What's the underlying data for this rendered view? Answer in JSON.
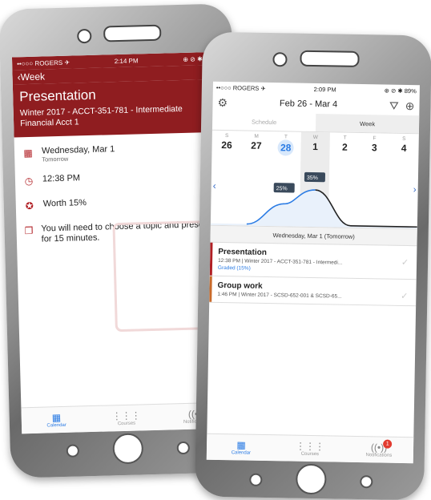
{
  "left": {
    "status": {
      "carrier": "••○○○ ROGERS ✈",
      "time": "2:14 PM",
      "right": "⊕ ⊘ ✱ 88%"
    },
    "nav": {
      "back": "‹Week",
      "edit": "E"
    },
    "header": {
      "title": "Presentation",
      "subtitle": "Winter 2017 - ACCT-351-781 - Intermediate Financial Acct 1"
    },
    "details": {
      "date": "Wednesday, Mar 1",
      "date_sub": "Tomorrow",
      "time": "12:38 PM",
      "worth": "Worth 15%",
      "note": "You will need to choose a topic and present it for 15 minutes."
    },
    "tabs": [
      "Calendar",
      "Courses",
      "Notifications"
    ]
  },
  "right": {
    "status": {
      "carrier": "••○○○ ROGERS ✈",
      "time": "2:09 PM",
      "right": "⊕ ⊘ ✱ 89%"
    },
    "nav": {
      "range": "Feb 26 - Mar 4"
    },
    "segments": [
      "Schedule",
      "Week"
    ],
    "days": [
      {
        "l": "S",
        "n": "26"
      },
      {
        "l": "M",
        "n": "27"
      },
      {
        "l": "T",
        "n": "28"
      },
      {
        "l": "W",
        "n": "1"
      },
      {
        "l": "T",
        "n": "2"
      },
      {
        "l": "F",
        "n": "3"
      },
      {
        "l": "S",
        "n": "4"
      }
    ],
    "graph_labels": [
      "25%",
      "35%"
    ],
    "banner": "Wednesday, Mar 1 (Tomorrow)",
    "events": [
      {
        "title": "Presentation",
        "meta": "12:38 PM | Winter 2017 - ACCT-351-781 - Intermedi...",
        "grade": "Graded (15%)",
        "color": "#b11f24"
      },
      {
        "title": "Group work",
        "meta": "1:46 PM | Winter 2017 - SCSD-652-001 & SCSD-65...",
        "color": "#c96a2a"
      }
    ],
    "tabs": [
      "Calendar",
      "Courses",
      "Notifications"
    ],
    "badge": "1"
  },
  "colors": {
    "brand": "#8f1d20",
    "accent": "#2a7be4"
  }
}
